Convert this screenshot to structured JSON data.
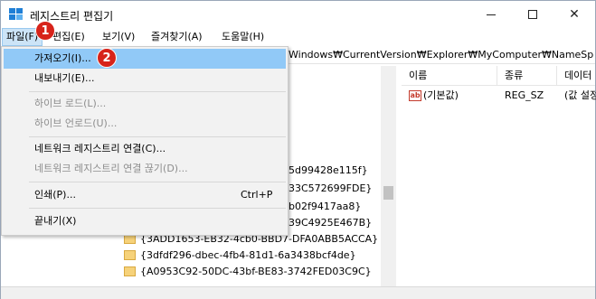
{
  "window": {
    "title": "레지스트리 편집기",
    "controls": {
      "minimize": "minimize-icon",
      "maximize": "maximize-icon",
      "close": "close-icon"
    }
  },
  "menubar": {
    "items": [
      "파일(F)",
      "편집(E)",
      "보기(V)",
      "즐겨찾기(A)",
      "도움말(H)"
    ]
  },
  "address": "Windows₩CurrentVersion₩Explorer₩MyComputer₩NameSpac",
  "file_menu": {
    "items": [
      {
        "label": "가져오기(I)...",
        "state": "highlighted"
      },
      {
        "label": "내보내기(E)...",
        "state": "enabled"
      },
      {
        "label": "하이브 로드(L)...",
        "state": "disabled"
      },
      {
        "label": "하이브 언로드(U)...",
        "state": "disabled"
      },
      {
        "label": "네트워크 레지스트리 연결(C)...",
        "state": "enabled"
      },
      {
        "label": "네트워크 레지스트리 연결 끊기(D)...",
        "state": "disabled"
      },
      {
        "label": "인쇄(P)...",
        "state": "enabled",
        "shortcut": "Ctrl+P"
      },
      {
        "label": "끝내기(X)",
        "state": "enabled"
      }
    ]
  },
  "tree": {
    "partial_rows": [
      "5d99428e115f}",
      "33C572699FDE}",
      "b02f9417aa8}",
      "39C4925E467B}"
    ],
    "rows": [
      "{3ADD1653-EB32-4cb0-BBD7-DFA0ABB5ACCA}",
      "{3dfdf296-dbec-4fb4-81d1-6a3438bcf4de}",
      "{A0953C92-50DC-43bf-BE83-3742FED03C9C}"
    ]
  },
  "values": {
    "columns": [
      "이름",
      "종류",
      "데이터"
    ],
    "rows": [
      {
        "name": "(기본값)",
        "type": "REG_SZ",
        "data": "(값 설정"
      }
    ]
  },
  "annotations": {
    "badge1": "1",
    "badge2": "2"
  },
  "colors": {
    "menu_highlight": "#91c9f7",
    "badge": "#d7231a",
    "active_menu": "#cce4f7"
  }
}
